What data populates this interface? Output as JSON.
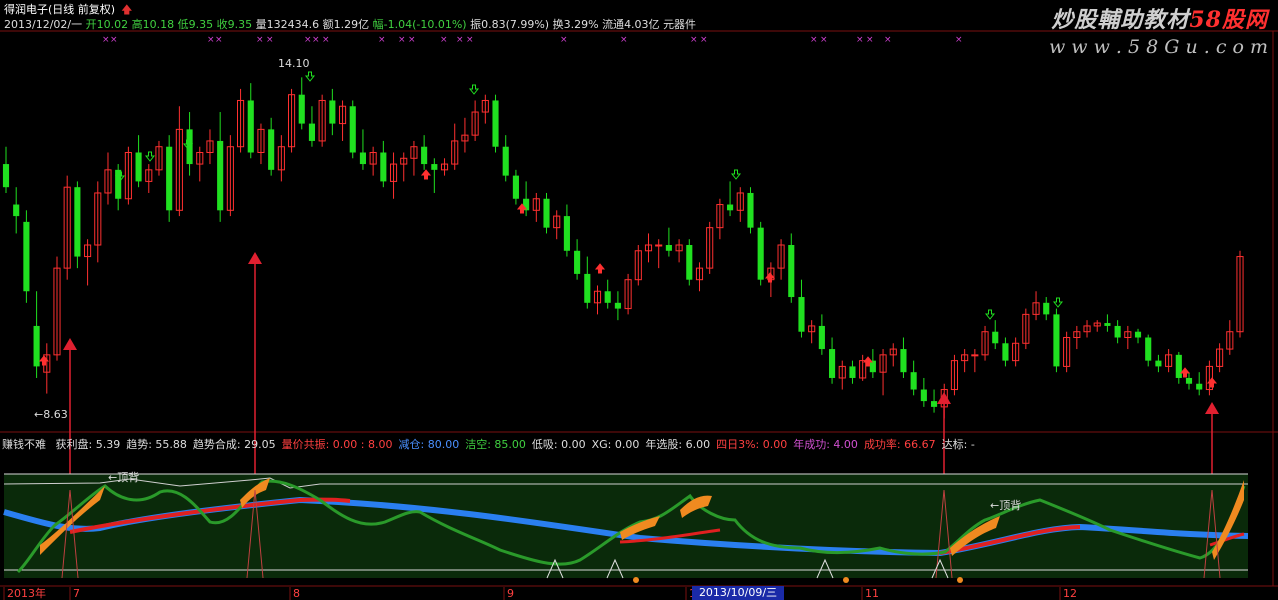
{
  "header": {
    "title": "得润电子(日线 前复权)",
    "title_arrow": "🡅",
    "date": "2013/12/02/一",
    "open_label": "开",
    "open": "10.02",
    "high_label": "高",
    "high": "10.18",
    "low_label": "低",
    "low": "9.35",
    "close_label": "收",
    "close": "9.35",
    "vol_label": "量",
    "vol": "132434.6",
    "amt_label": "额",
    "amt": "1.29亿",
    "chg_label": "幅",
    "chg": "-1.04(-10.01%)",
    "amp_label": "振",
    "amp": "0.83(7.99%)",
    "turn_label": "换",
    "turn": "3.29%",
    "float_label": "流通",
    "float": "4.03亿",
    "sector": "元器件"
  },
  "watermark": {
    "line1_a": "炒股輔助教材",
    "line1_b": "58股网",
    "line2": "w w w . 5 8 G u . c o m"
  },
  "price_labels": {
    "high": "14.10",
    "low": "←8.63"
  },
  "indicator": {
    "name": "赚钱不难",
    "items": [
      {
        "text": "获利盘: 5.39",
        "color": "#dddddd"
      },
      {
        "text": "趋势: 55.88",
        "color": "#dddddd"
      },
      {
        "text": "趋势合成: 29.05",
        "color": "#dddddd"
      },
      {
        "text": "量价共振: 0.00 : 8.00",
        "color": "#ff4040"
      },
      {
        "text": "减仓: 80.00",
        "color": "#4a90ff"
      },
      {
        "text": "洁空: 85.00",
        "color": "#40d040"
      },
      {
        "text": "低吸: 0.00",
        "color": "#dddddd"
      },
      {
        "text": "XG: 0.00",
        "color": "#dddddd"
      },
      {
        "text": "年选股: 6.00",
        "color": "#dddddd"
      },
      {
        "text": "四日3%: 0.00",
        "color": "#ff4040"
      },
      {
        "text": "年成功: 4.00",
        "color": "#d050d0"
      },
      {
        "text": "成功率: 66.67",
        "color": "#ff4040"
      },
      {
        "text": "达标: -",
        "color": "#dddddd"
      }
    ],
    "top_back_label_1": "←顶背",
    "top_back_label_2": "←顶背"
  },
  "axis": {
    "labels": [
      "2013年",
      "7",
      "8",
      "9",
      "1",
      "11",
      "12"
    ],
    "highlight_date": "2013/10/09/三"
  },
  "colors": {
    "up": "#ff3030",
    "down": "#20e020",
    "bg": "#000000",
    "osc_bg": "#0a2a0a",
    "blue_line": "#2a7ff0",
    "red_line": "#e02020",
    "orange": "#f08a20",
    "green_line": "#2a9a2a",
    "signal_arrow": "#e02030",
    "marker": "#d040d0"
  },
  "chart_data": {
    "type": "candlestick",
    "candles": [
      [
        12.6,
        12.9,
        12.1,
        12.2
      ],
      [
        11.9,
        12.2,
        11.4,
        11.7
      ],
      [
        11.6,
        11.8,
        10.2,
        10.4
      ],
      [
        9.8,
        10.4,
        8.9,
        9.1
      ],
      [
        9.0,
        9.5,
        8.63,
        9.3
      ],
      [
        9.3,
        11.0,
        9.2,
        10.8
      ],
      [
        10.8,
        12.4,
        10.6,
        12.2
      ],
      [
        12.2,
        12.3,
        10.8,
        11.0
      ],
      [
        11.0,
        11.3,
        10.5,
        11.2
      ],
      [
        11.2,
        12.3,
        10.9,
        12.1
      ],
      [
        12.1,
        12.8,
        11.9,
        12.5
      ],
      [
        12.5,
        12.6,
        11.8,
        12.0
      ],
      [
        12.0,
        12.9,
        11.9,
        12.8
      ],
      [
        12.8,
        13.1,
        12.2,
        12.3
      ],
      [
        12.3,
        12.6,
        12.1,
        12.5
      ],
      [
        12.5,
        13.0,
        12.4,
        12.9
      ],
      [
        12.9,
        13.1,
        11.6,
        11.8
      ],
      [
        11.8,
        13.6,
        11.7,
        13.2
      ],
      [
        13.2,
        13.5,
        12.4,
        12.6
      ],
      [
        12.6,
        12.9,
        12.3,
        12.8
      ],
      [
        12.8,
        13.2,
        12.6,
        13.0
      ],
      [
        13.0,
        13.5,
        11.6,
        11.8
      ],
      [
        11.8,
        13.1,
        11.7,
        12.9
      ],
      [
        12.9,
        13.9,
        12.8,
        13.7
      ],
      [
        13.7,
        14.0,
        12.7,
        12.8
      ],
      [
        12.8,
        13.3,
        12.6,
        13.2
      ],
      [
        13.2,
        13.4,
        12.4,
        12.5
      ],
      [
        12.5,
        13.1,
        12.3,
        12.9
      ],
      [
        12.9,
        13.9,
        12.8,
        13.8
      ],
      [
        13.8,
        14.1,
        13.2,
        13.3
      ],
      [
        13.3,
        13.6,
        12.9,
        13.0
      ],
      [
        13.0,
        13.8,
        12.9,
        13.7
      ],
      [
        13.7,
        13.9,
        13.1,
        13.3
      ],
      [
        13.3,
        13.7,
        13.0,
        13.6
      ],
      [
        13.6,
        13.7,
        12.7,
        12.8
      ],
      [
        12.8,
        13.2,
        12.5,
        12.6
      ],
      [
        12.6,
        12.9,
        12.4,
        12.8
      ],
      [
        12.8,
        13.0,
        12.2,
        12.3
      ],
      [
        12.3,
        12.8,
        12.0,
        12.6
      ],
      [
        12.6,
        12.8,
        12.3,
        12.7
      ],
      [
        12.7,
        13.0,
        12.4,
        12.9
      ],
      [
        12.9,
        13.1,
        12.5,
        12.6
      ],
      [
        12.6,
        12.7,
        12.1,
        12.5
      ],
      [
        12.5,
        12.7,
        12.4,
        12.6
      ],
      [
        12.6,
        13.3,
        12.5,
        13.0
      ],
      [
        13.0,
        13.4,
        12.8,
        13.1
      ],
      [
        13.1,
        13.7,
        13.0,
        13.5
      ],
      [
        13.5,
        13.8,
        13.3,
        13.7
      ],
      [
        13.7,
        13.8,
        12.8,
        12.9
      ],
      [
        12.9,
        13.1,
        12.3,
        12.4
      ],
      [
        12.4,
        12.5,
        11.9,
        12.0
      ],
      [
        12.0,
        12.3,
        11.7,
        11.8
      ],
      [
        11.8,
        12.1,
        11.6,
        12.0
      ],
      [
        12.0,
        12.1,
        11.4,
        11.5
      ],
      [
        11.5,
        11.8,
        11.3,
        11.7
      ],
      [
        11.7,
        11.9,
        11.0,
        11.1
      ],
      [
        11.1,
        11.3,
        10.6,
        10.7
      ],
      [
        10.7,
        11.0,
        10.1,
        10.2
      ],
      [
        10.2,
        10.5,
        10.0,
        10.4
      ],
      [
        10.4,
        10.6,
        10.1,
        10.2
      ],
      [
        10.2,
        10.4,
        9.9,
        10.1
      ],
      [
        10.1,
        10.7,
        10.0,
        10.6
      ],
      [
        10.6,
        11.2,
        10.5,
        11.1
      ],
      [
        11.1,
        11.4,
        10.9,
        11.2
      ],
      [
        11.2,
        11.3,
        10.8,
        11.2
      ],
      [
        11.2,
        11.5,
        11.0,
        11.1
      ],
      [
        11.1,
        11.3,
        10.9,
        11.2
      ],
      [
        11.2,
        11.3,
        10.5,
        10.6
      ],
      [
        10.6,
        10.9,
        10.4,
        10.8
      ],
      [
        10.8,
        11.6,
        10.7,
        11.5
      ],
      [
        11.5,
        12.0,
        11.3,
        11.9
      ],
      [
        11.9,
        12.3,
        11.7,
        11.8
      ],
      [
        11.8,
        12.2,
        11.6,
        12.1
      ],
      [
        12.1,
        12.2,
        11.4,
        11.5
      ],
      [
        11.5,
        11.6,
        10.5,
        10.6
      ],
      [
        10.6,
        10.9,
        10.3,
        10.8
      ],
      [
        10.8,
        11.3,
        10.6,
        11.2
      ],
      [
        11.2,
        11.4,
        10.2,
        10.3
      ],
      [
        10.3,
        10.6,
        9.6,
        9.7
      ],
      [
        9.7,
        9.9,
        9.5,
        9.8
      ],
      [
        9.8,
        10.0,
        9.3,
        9.4
      ],
      [
        9.4,
        9.6,
        8.8,
        8.9
      ],
      [
        8.9,
        9.2,
        8.7,
        9.1
      ],
      [
        9.1,
        9.2,
        8.8,
        8.9
      ],
      [
        8.9,
        9.3,
        8.85,
        9.2
      ],
      [
        9.2,
        9.4,
        8.9,
        9.0
      ],
      [
        9.0,
        9.4,
        8.6,
        9.3
      ],
      [
        9.3,
        9.5,
        9.1,
        9.4
      ],
      [
        9.4,
        9.6,
        8.9,
        9.0
      ],
      [
        9.0,
        9.2,
        8.6,
        8.7
      ],
      [
        8.7,
        8.9,
        8.4,
        8.5
      ],
      [
        8.5,
        8.7,
        8.3,
        8.4
      ],
      [
        8.4,
        8.8,
        8.2,
        8.7
      ],
      [
        8.7,
        9.3,
        8.6,
        9.2
      ],
      [
        9.2,
        9.4,
        9.0,
        9.3
      ],
      [
        9.3,
        9.4,
        9.0,
        9.3
      ],
      [
        9.3,
        9.8,
        9.2,
        9.7
      ],
      [
        9.7,
        9.9,
        9.4,
        9.5
      ],
      [
        9.5,
        9.6,
        9.1,
        9.2
      ],
      [
        9.2,
        9.6,
        9.1,
        9.5
      ],
      [
        9.5,
        10.1,
        9.4,
        10.0
      ],
      [
        10.0,
        10.4,
        9.9,
        10.2
      ],
      [
        10.2,
        10.3,
        9.9,
        10.0
      ],
      [
        10.0,
        10.1,
        9.0,
        9.1
      ],
      [
        9.1,
        9.7,
        9.0,
        9.6
      ],
      [
        9.6,
        9.8,
        9.4,
        9.7
      ],
      [
        9.7,
        9.9,
        9.6,
        9.8
      ],
      [
        9.8,
        9.9,
        9.7,
        9.85
      ],
      [
        9.85,
        10.0,
        9.7,
        9.8
      ],
      [
        9.8,
        9.9,
        9.5,
        9.6
      ],
      [
        9.6,
        9.8,
        9.4,
        9.7
      ],
      [
        9.7,
        9.75,
        9.5,
        9.6
      ],
      [
        9.6,
        9.65,
        9.1,
        9.2
      ],
      [
        9.2,
        9.3,
        9.0,
        9.1
      ],
      [
        9.1,
        9.4,
        9.0,
        9.3
      ],
      [
        9.3,
        9.35,
        8.8,
        8.9
      ],
      [
        8.9,
        9.0,
        8.7,
        8.8
      ],
      [
        8.8,
        9.0,
        8.6,
        8.7
      ],
      [
        8.7,
        9.2,
        8.6,
        9.1
      ],
      [
        9.1,
        9.5,
        9.0,
        9.4
      ],
      [
        9.4,
        9.9,
        9.3,
        9.7
      ],
      [
        9.7,
        11.1,
        9.6,
        11.0
      ]
    ]
  }
}
